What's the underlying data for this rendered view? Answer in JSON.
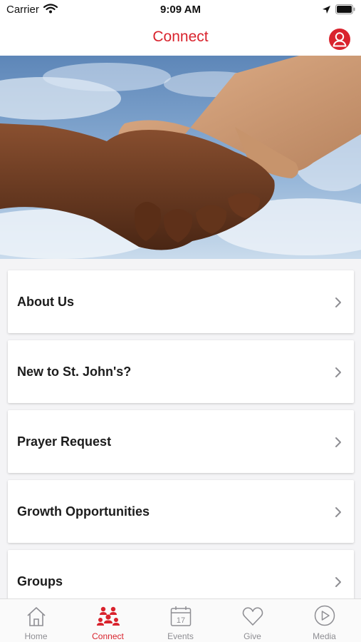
{
  "status_bar": {
    "carrier": "Carrier",
    "time": "9:09 AM"
  },
  "nav": {
    "title": "Connect"
  },
  "hero": {
    "image": "handshake-photo"
  },
  "menu": {
    "items": [
      {
        "label": "About Us"
      },
      {
        "label": "New to St. John's?"
      },
      {
        "label": "Prayer Request"
      },
      {
        "label": "Growth Opportunities"
      },
      {
        "label": "Groups"
      }
    ]
  },
  "tab_bar": {
    "tabs": [
      {
        "label": "Home",
        "icon": "home-icon",
        "active": false
      },
      {
        "label": "Connect",
        "icon": "people-icon",
        "active": true
      },
      {
        "label": "Events",
        "icon": "calendar-icon",
        "active": false,
        "day": "17"
      },
      {
        "label": "Give",
        "icon": "heart-icon",
        "active": false
      },
      {
        "label": "Media",
        "icon": "play-icon",
        "active": false
      }
    ]
  },
  "colors": {
    "accent": "#d9232d",
    "inactive": "#8e8e93",
    "background": "#f4f4f6"
  }
}
